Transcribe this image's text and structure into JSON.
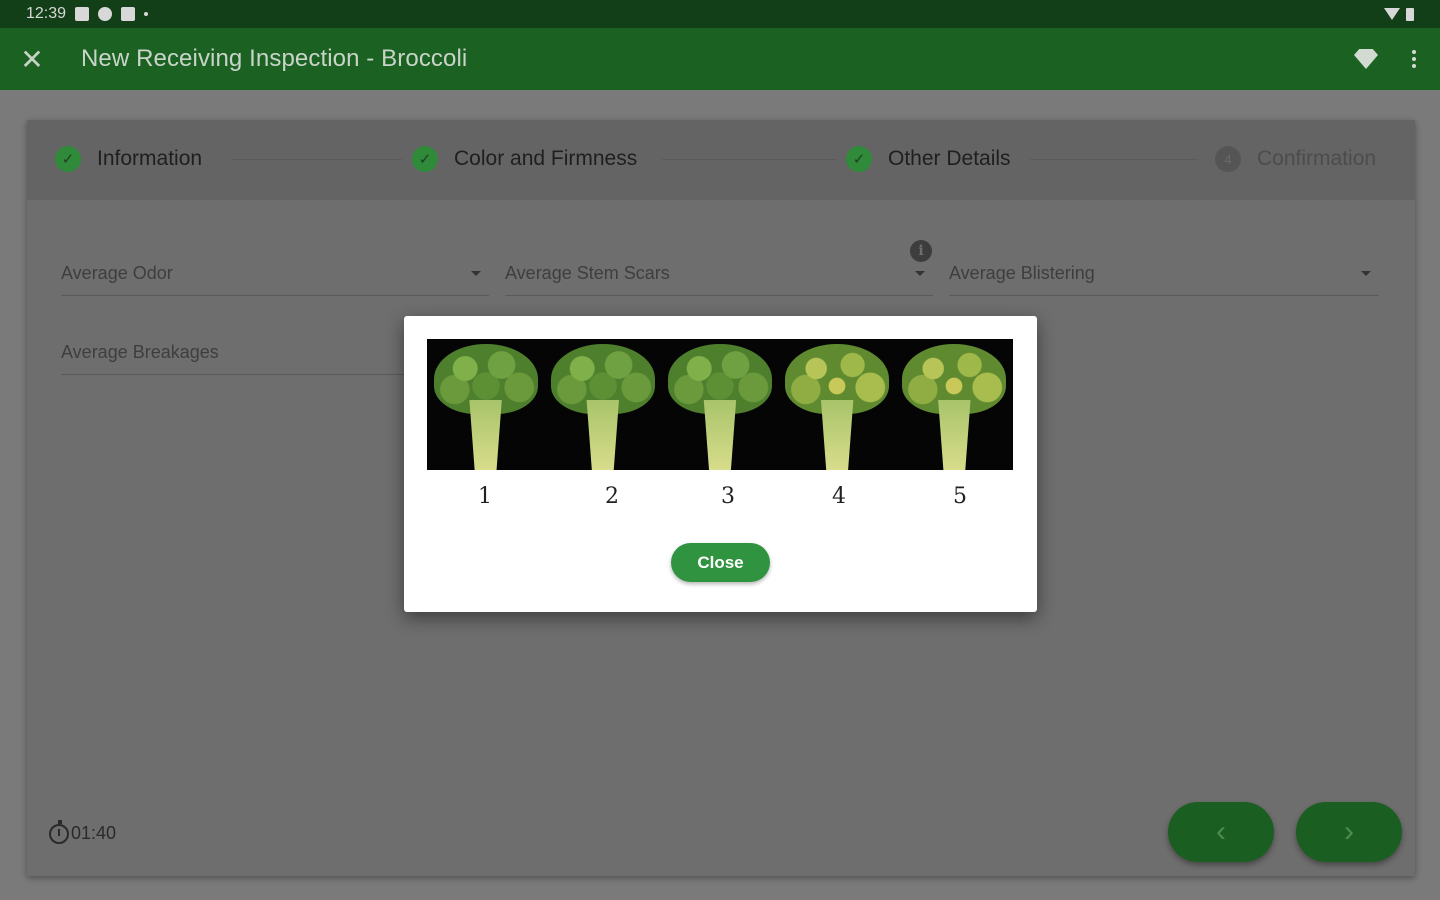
{
  "status_bar": {
    "time": "12:39"
  },
  "app_bar": {
    "title": "New Receiving Inspection - Broccoli",
    "close_icon": "close-icon",
    "actions": [
      "diamond-icon",
      "more-vert-icon"
    ]
  },
  "stepper": {
    "steps": [
      {
        "label": "Information",
        "state": "done"
      },
      {
        "label": "Color and Firmness",
        "state": "done"
      },
      {
        "label": "Other Details",
        "state": "done"
      },
      {
        "label": "Confirmation",
        "state": "pending",
        "number": "4"
      }
    ]
  },
  "form": {
    "fields": [
      {
        "label": "Average Odor"
      },
      {
        "label": "Average Stem Scars"
      },
      {
        "label": "Average Blistering"
      },
      {
        "label": "Average Breakages"
      }
    ],
    "info_icon_text": "i"
  },
  "timer": {
    "value": "01:40"
  },
  "dialog": {
    "scale_labels": [
      "1",
      "2",
      "3",
      "4",
      "5"
    ],
    "close_label": "Close"
  },
  "nav": {
    "prev_glyph": "‹",
    "next_glyph": "›"
  },
  "colors": {
    "app_bar": "#1b6122",
    "status_bar": "#123f17",
    "accent": "#2f9340"
  }
}
